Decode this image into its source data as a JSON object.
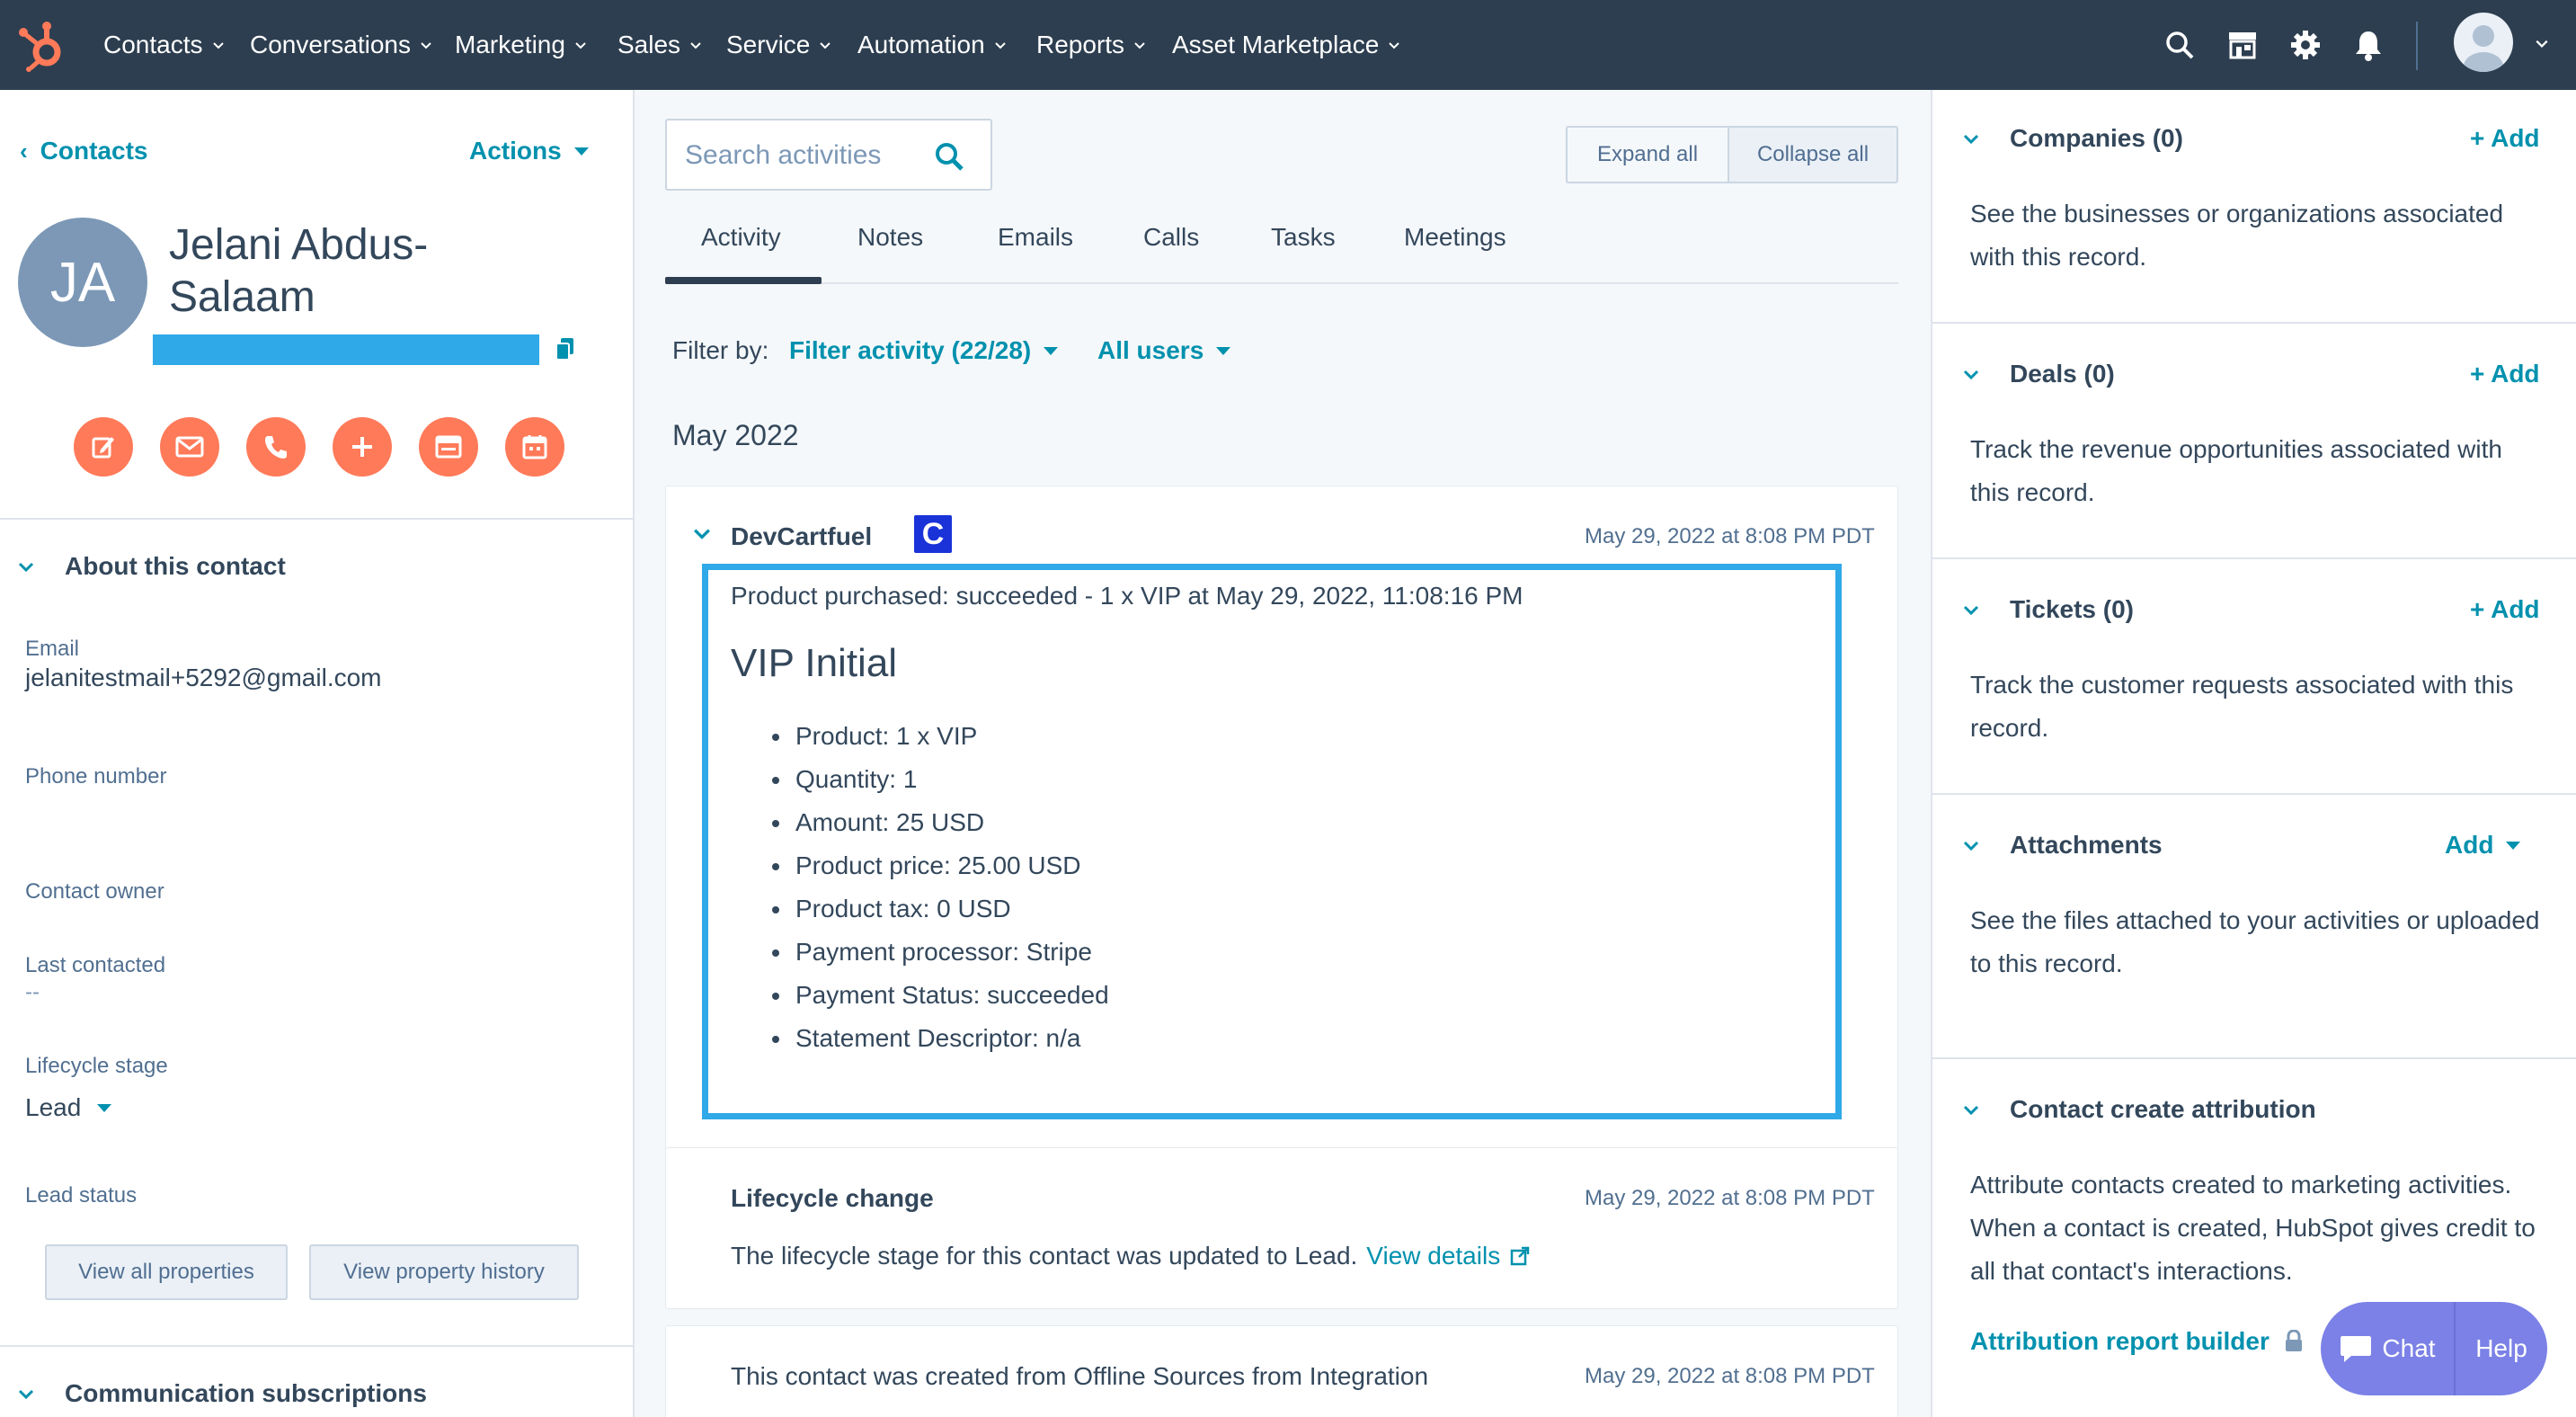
{
  "nav": {
    "items": [
      {
        "label": "Contacts"
      },
      {
        "label": "Conversations"
      },
      {
        "label": "Marketing"
      },
      {
        "label": "Sales"
      },
      {
        "label": "Service"
      },
      {
        "label": "Automation"
      },
      {
        "label": "Reports"
      },
      {
        "label": "Asset Marketplace"
      }
    ],
    "icons": [
      "search-icon",
      "marketplace-icon",
      "settings-icon",
      "notifications-icon",
      "user-avatar"
    ]
  },
  "left": {
    "back_label": "Contacts",
    "actions_label": "Actions",
    "avatar_initials": "JA",
    "name": "Jelani Abdus-Salaam",
    "action_icons": [
      "note-icon",
      "email-icon",
      "call-icon",
      "add-icon",
      "log-activity-icon",
      "meeting-icon"
    ],
    "about_heading": "About this contact",
    "properties": [
      {
        "label": "Email",
        "value": "jelanitestmail+5292@gmail.com"
      },
      {
        "label": "Phone number",
        "value": ""
      },
      {
        "label": "Contact owner",
        "value": ""
      },
      {
        "label": "Last contacted",
        "value": "--"
      },
      {
        "label": "Lifecycle stage",
        "value": "Lead"
      },
      {
        "label": "Lead status",
        "value": ""
      }
    ],
    "view_all_label": "View all properties",
    "view_history_label": "View property history",
    "comm_heading": "Communication subscriptions"
  },
  "center": {
    "search_placeholder": "Search activities",
    "expand_label": "Expand all",
    "collapse_label": "Collapse all",
    "tabs": [
      {
        "label": "Activity"
      },
      {
        "label": "Notes"
      },
      {
        "label": "Emails"
      },
      {
        "label": "Calls"
      },
      {
        "label": "Tasks"
      },
      {
        "label": "Meetings"
      }
    ],
    "filter_label": "Filter by:",
    "filter_activity": "Filter activity (22/28)",
    "filter_users": "All users",
    "month": "May 2022",
    "cards": [
      {
        "title": "DevCartfuel",
        "logo_letter": "C",
        "timestamp": "May 29, 2022 at 8:08 PM PDT",
        "summary": "Product purchased: succeeded - 1 x VIP at May 29, 2022, 11:08:16 PM",
        "heading": "VIP Initial",
        "bullets": [
          "Product: 1 x VIP",
          "Quantity: 1",
          "Amount: 25 USD",
          "Product price: 25.00 USD",
          "Product tax: 0 USD",
          "Payment processor: Stripe",
          "Payment Status: succeeded",
          "Statement Descriptor: n/a"
        ]
      },
      {
        "title": "Lifecycle change",
        "timestamp": "May 29, 2022 at 8:08 PM PDT",
        "text": "The lifecycle stage for this contact was updated to Lead.",
        "link": "View details"
      },
      {
        "text": "This contact was created from Offline Sources from Integration",
        "timestamp": "May 29, 2022 at 8:08 PM PDT"
      }
    ]
  },
  "right": {
    "sections": [
      {
        "title": "Companies (0)",
        "add": "+ Add",
        "desc": "See the businesses or organizations associated with this record."
      },
      {
        "title": "Deals (0)",
        "add": "+ Add",
        "desc": "Track the revenue opportunities associated with this record."
      },
      {
        "title": "Tickets (0)",
        "add": "+ Add",
        "desc": "Track the customer requests associated with this record."
      },
      {
        "title": "Attachments",
        "add": "Add",
        "desc": "See the files attached to your activities or uploaded to this record."
      },
      {
        "title": "Contact create attribution",
        "desc": "Attribute contacts created to marketing activities. When a contact is created, HubSpot gives credit to all that contact's interactions."
      }
    ],
    "attribution_link": "Attribution report builder"
  },
  "chat": {
    "chat_label": "Chat",
    "help_label": "Help"
  },
  "colors": {
    "nav_bg": "#2d3e50",
    "accent_link": "#0091ae",
    "action_orange": "#ff7a59",
    "highlight_blue": "#2fa9e8",
    "chat_purple": "#7b81e6"
  }
}
